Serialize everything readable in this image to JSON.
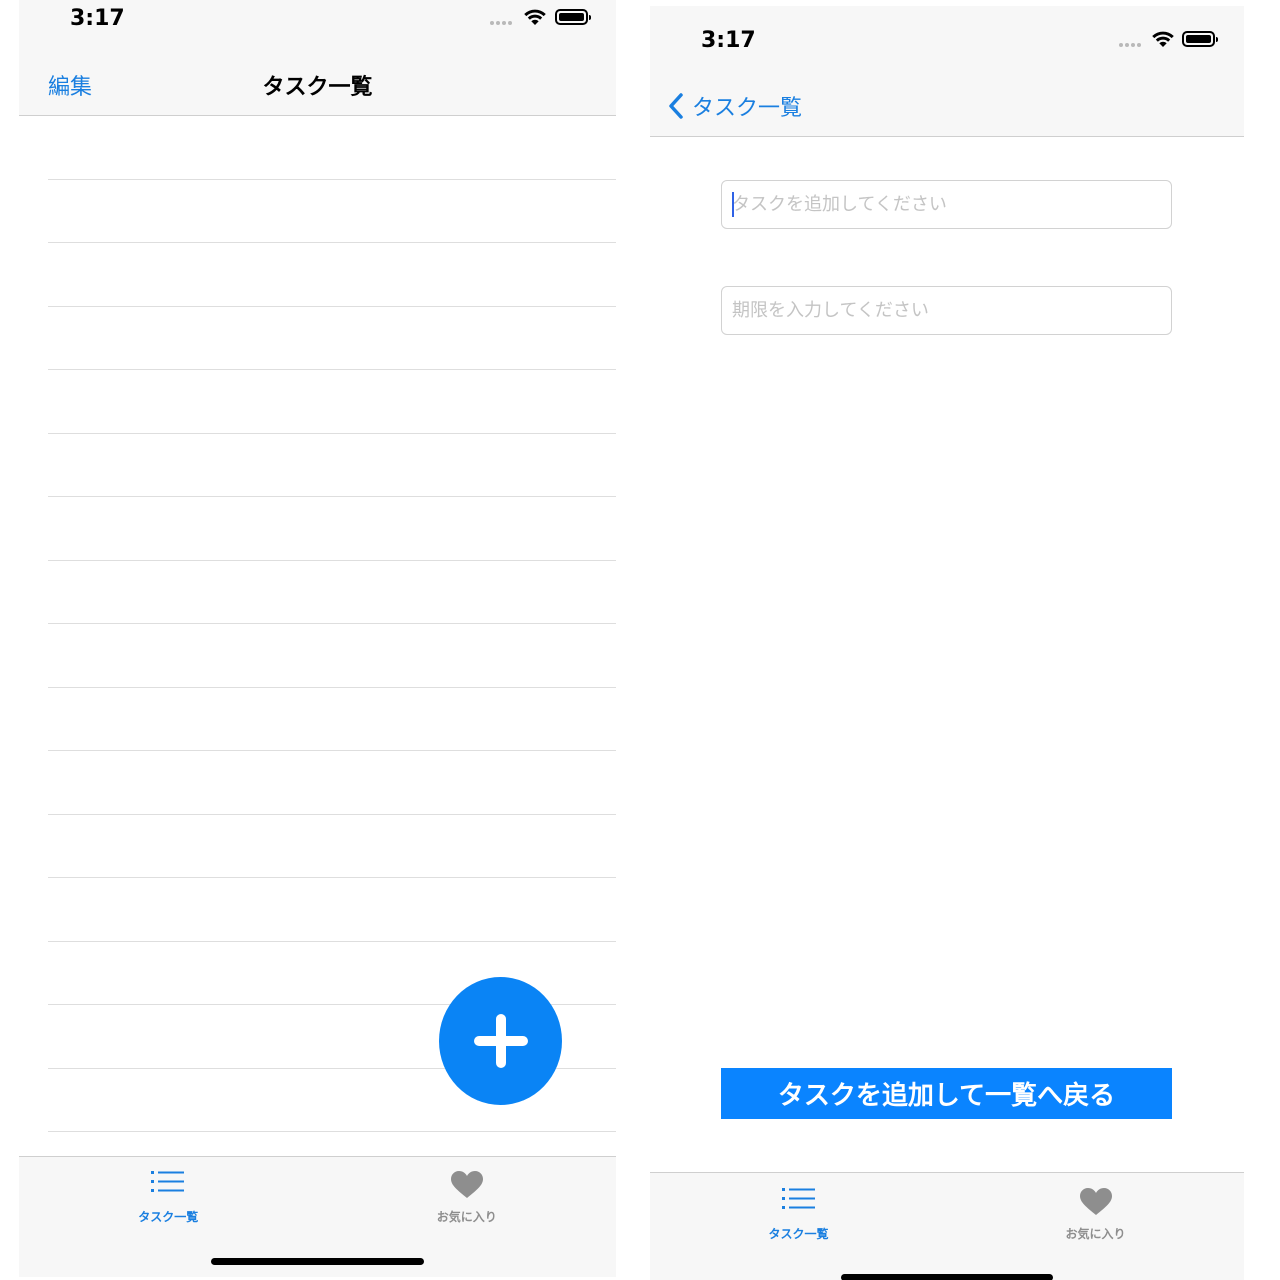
{
  "left_screen": {
    "status_bar": {
      "time": "3:17"
    },
    "nav_bar": {
      "edit_label": "編集",
      "title": "タスク一覧"
    },
    "table": {
      "row_count": 16
    },
    "fab": {
      "icon": "plus-icon",
      "color": "#0a84f5"
    },
    "tab_bar": {
      "items": [
        {
          "label": "タスク一覧",
          "icon": "list-icon",
          "active": true
        },
        {
          "label": "お気に入り",
          "icon": "heart-icon",
          "active": false
        }
      ]
    }
  },
  "right_screen": {
    "status_bar": {
      "time": "3:17"
    },
    "nav_bar": {
      "back_label": "タスク一覧"
    },
    "form": {
      "task_field": {
        "value": "",
        "placeholder": "タスクを追加してください"
      },
      "deadline_field": {
        "value": "",
        "placeholder": "期限を入力してください"
      },
      "submit_label": "タスクを追加して一覧へ戻る"
    },
    "tab_bar": {
      "items": [
        {
          "label": "タスク一覧",
          "icon": "list-icon",
          "active": true
        },
        {
          "label": "お気に入り",
          "icon": "heart-icon",
          "active": false
        }
      ]
    }
  },
  "colors": {
    "accent": "#1a7fe0",
    "button": "#0a84ff",
    "inactive": "#8e8e8e"
  }
}
